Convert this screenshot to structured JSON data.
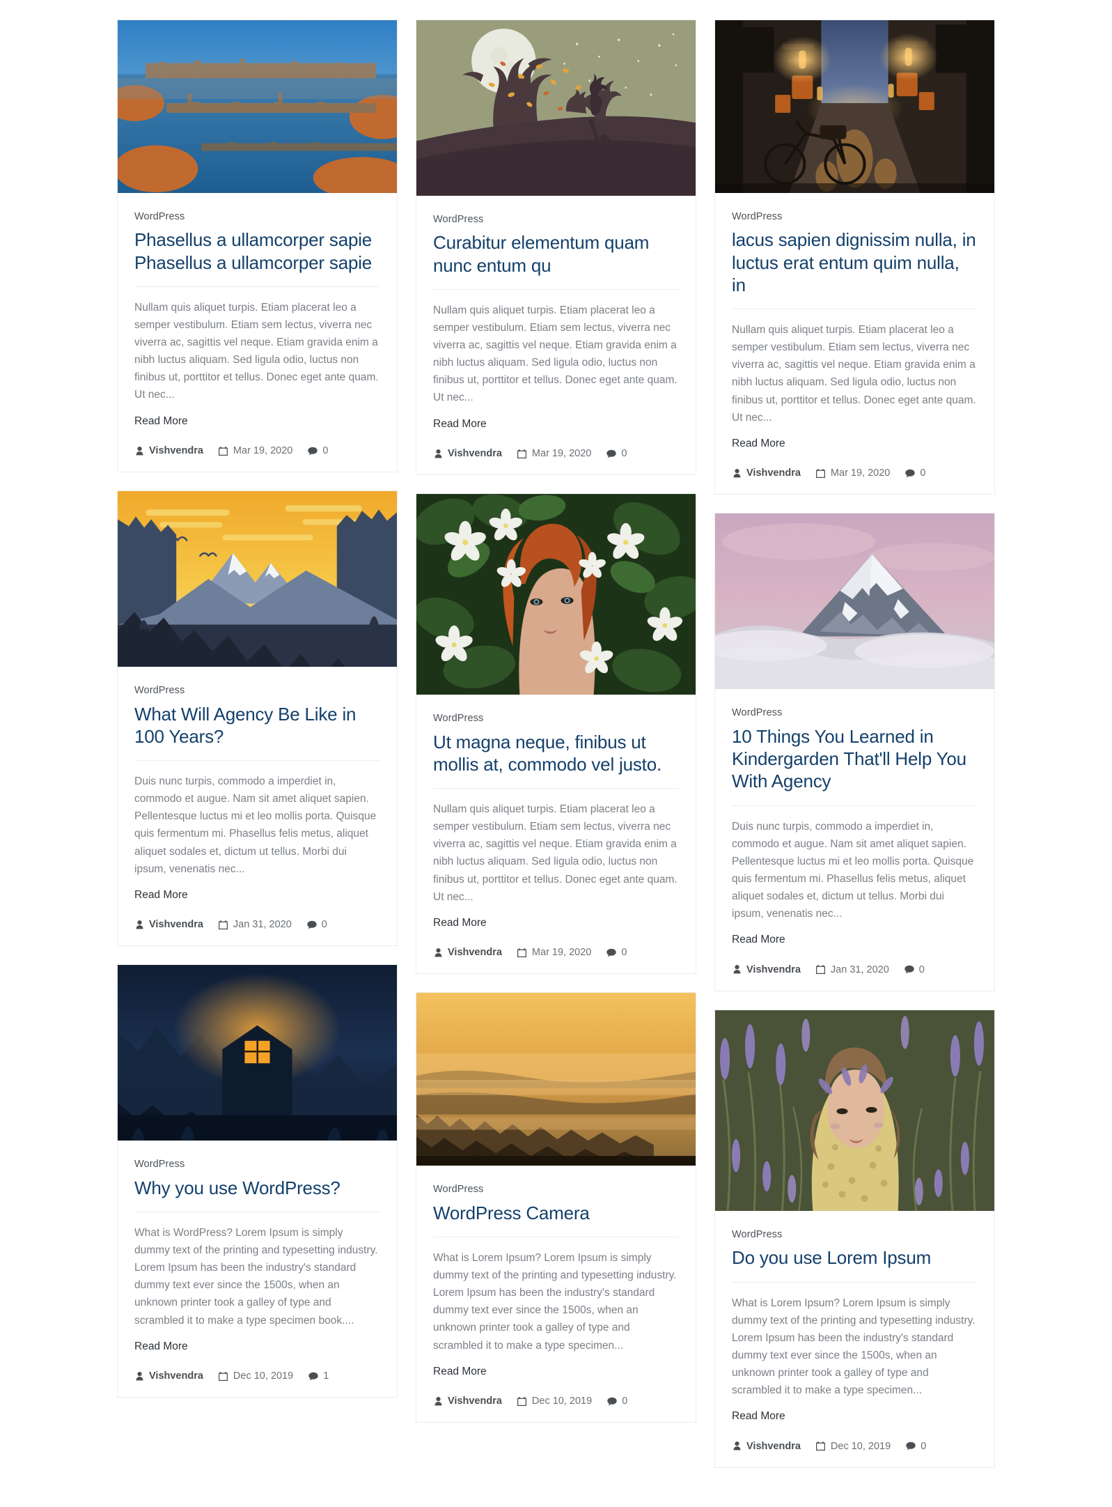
{
  "site": {
    "background": "#ffffff",
    "card_border": "#ececec",
    "title_color": "#14406b",
    "body_color": "#7b7f85",
    "meta_color": "#5f6469"
  },
  "labels": {
    "read_more": "Read More",
    "author_icon": "user-icon",
    "date_icon": "calendar-icon",
    "comments_icon": "comment-icon"
  },
  "posts": [
    {
      "id": "phasellus-a-ullamcorper-sapie",
      "column": 1,
      "image": "prague-bridges-autumn-cityscape",
      "image_alt": "Aerial view of Prague bridges over the river in autumn",
      "category": "WordPress",
      "title": "Phasellus a ullamcorper sapie Phasellus a ullamcorper sapie",
      "excerpt": "Nullam quis aliquet turpis. Etiam placerat leo a semper vestibulum. Etiam sem lectus, viverra nec viverra ac, sagittis vel neque. Etiam gravida enim a nibh luctus aliquam. Sed ligula odio, luctus non finibus ut, porttitor et tellus. Donec eget ante quam. Ut nec...",
      "read_more": "Read More",
      "author": "Vishvendra",
      "date": "Mar 19, 2020",
      "comments": "0"
    },
    {
      "id": "what-will-agency-be-like-in-100-years",
      "column": 1,
      "image": "mountain-sunset-flat-illustration",
      "image_alt": "Flat illustration of mountains at sunset with pine trees",
      "category": "WordPress",
      "title": "What Will Agency Be Like in 100 Years?",
      "excerpt": "Duis nunc turpis, commodo a imperdiet in, commodo et augue. Nam sit amet aliquet sapien. Pellentesque luctus mi et leo mollis porta. Quisque quis fermentum mi. Phasellus felis metus, aliquet aliquet sodales et, dictum ut tellus. Morbi dui ipsum, venenatis nec...",
      "read_more": "Read More",
      "author": "Vishvendra",
      "date": "Jan 31, 2020",
      "comments": "0"
    },
    {
      "id": "why-you-use-wordpress",
      "column": 1,
      "image": "night-forest-cabin-lit-window",
      "image_alt": "Dark forest at night with a glowing cabin window",
      "category": "WordPress",
      "title": "Why you use WordPress?",
      "excerpt": "What is WordPress? Lorem Ipsum is simply dummy text of the printing and typesetting industry. Lorem Ipsum has been the industry's standard dummy text ever since the 1500s, when an unknown printer took a galley of type and scrambled it to make a type specimen book....",
      "read_more": "Read More",
      "author": "Vishvendra",
      "date": "Dec 10, 2019",
      "comments": "1"
    },
    {
      "id": "curabitur-elementum-quam-nunc-entum-qu",
      "column": 2,
      "image": "autumn-tree-moon-girl-silhouette",
      "image_alt": "Silhouette of a girl running past an autumn tree under a full moon",
      "category": "WordPress",
      "title": "Curabitur elementum quam nunc entum qu",
      "excerpt": "Nullam quis aliquet turpis. Etiam placerat leo a semper vestibulum. Etiam sem lectus, viverra nec viverra ac, sagittis vel neque. Etiam gravida enim a nibh luctus aliquam. Sed ligula odio, luctus non finibus ut, porttitor et tellus. Donec eget ante quam. Ut nec...",
      "read_more": "Read More",
      "author": "Vishvendra",
      "date": "Mar 19, 2020",
      "comments": "0"
    },
    {
      "id": "ut-magna-neque-finibus-ut-mollis-at",
      "column": 2,
      "image": "redhead-woman-in-white-blossoms",
      "image_alt": "Red haired woman surrounded by white blossom flowers",
      "category": "WordPress",
      "title": "Ut magna neque, finibus ut mollis at, commodo vel justo.",
      "excerpt": "Nullam quis aliquet turpis. Etiam placerat leo a semper vestibulum. Etiam sem lectus, viverra nec viverra ac, sagittis vel neque. Etiam gravida enim a nibh luctus aliquam. Sed ligula odio, luctus non finibus ut, porttitor et tellus. Donec eget ante quam. Ut nec...",
      "read_more": "Read More",
      "author": "Vishvendra",
      "date": "Mar 19, 2020",
      "comments": "0"
    },
    {
      "id": "wordpress-camera",
      "column": 2,
      "image": "golden-misty-valley-sunrise",
      "image_alt": "Golden misty valley at sunrise with forested hills",
      "category": "WordPress",
      "title": "WordPress Camera",
      "excerpt": "What is Lorem Ipsum? Lorem Ipsum is simply dummy text of the printing and typesetting industry. Lorem Ipsum has been the industry's standard dummy text ever since the 1500s, when an unknown printer took a galley of type and scrambled it to make a type specimen...",
      "read_more": "Read More",
      "author": "Vishvendra",
      "date": "Dec 10, 2019",
      "comments": "0"
    },
    {
      "id": "lacus-sapien-dignissim-nulla",
      "column": 3,
      "image": "japanese-alley-night-bicycle",
      "image_alt": "Narrow Japanese street alley at night with a bicycle and lanterns",
      "category": "WordPress",
      "title": "lacus sapien dignissim nulla, in luctus erat entum quim nulla, in",
      "excerpt": "Nullam quis aliquet turpis. Etiam placerat leo a semper vestibulum. Etiam sem lectus, viverra nec viverra ac, sagittis vel neque. Etiam gravida enim a nibh luctus aliquam. Sed ligula odio, luctus non finibus ut, porttitor et tellus. Donec eget ante quam. Ut nec...",
      "read_more": "Read More",
      "author": "Vishvendra",
      "date": "Mar 19, 2020",
      "comments": "0"
    },
    {
      "id": "10-things-you-learned-in-kindergarden",
      "column": 3,
      "image": "snowy-mountain-peak-pink-sky",
      "image_alt": "Snow covered mountain peak above clouds under a pink sky",
      "category": "WordPress",
      "title": "10 Things You Learned in Kindergarden That'll Help You With Agency",
      "excerpt": "Duis nunc turpis, commodo a imperdiet in, commodo et augue. Nam sit amet aliquet sapien. Pellentesque luctus mi et leo mollis porta. Quisque quis fermentum mi. Phasellus felis metus, aliquet aliquet sodales et, dictum ut tellus. Morbi dui ipsum, venenatis nec...",
      "read_more": "Read More",
      "author": "Vishvendra",
      "date": "Jan 31, 2020",
      "comments": "0"
    },
    {
      "id": "do-you-use-lorem-ipsum",
      "column": 3,
      "image": "woman-lying-in-lavender-field",
      "image_alt": "Woman lying in a field of lavender flowers",
      "category": "WordPress",
      "title": "Do you use Lorem Ipsum",
      "excerpt": "What is Lorem Ipsum? Lorem Ipsum is simply dummy text of the printing and typesetting industry. Lorem Ipsum has been the industry's standard dummy text ever since the 1500s, when an unknown printer took a galley of type and scrambled it to make a type specimen...",
      "read_more": "Read More",
      "author": "Vishvendra",
      "date": "Dec 10, 2019",
      "comments": "0"
    }
  ]
}
